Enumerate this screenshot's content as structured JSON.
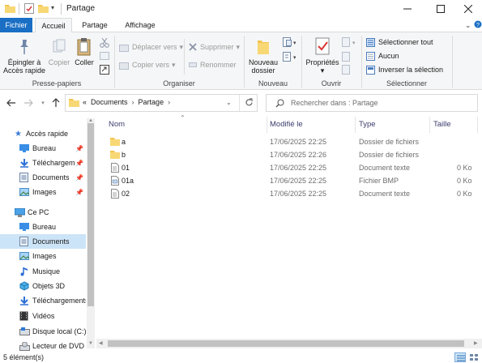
{
  "window": {
    "title": "Partage"
  },
  "tabs": {
    "file": "Fichier",
    "home": "Accueil",
    "share": "Partage",
    "view": "Affichage"
  },
  "ribbon": {
    "pin": "Épingler à\nAccès rapide",
    "pin_line1": "Épingler à",
    "pin_line2": "Accès rapide",
    "copy": "Copier",
    "paste": "Coller",
    "clipboard_group": "Presse-papiers",
    "move_to": "Déplacer vers",
    "copy_to": "Copier vers",
    "delete": "Supprimer",
    "rename": "Renommer",
    "organize_group": "Organiser",
    "new_folder_line1": "Nouveau",
    "new_folder_line2": "dossier",
    "new_group": "Nouveau",
    "properties": "Propriétés",
    "open_group": "Ouvrir",
    "select_all": "Sélectionner tout",
    "select_none": "Aucun",
    "invert_selection": "Inverser la sélection",
    "select_group": "Sélectionner"
  },
  "address": {
    "overflow": "«",
    "crumbs": [
      "Documents",
      "Partage"
    ],
    "search_placeholder": "Rechercher dans : Partage"
  },
  "nav": {
    "quick_access": "Accès rapide",
    "quick_items": [
      "Bureau",
      "Téléchargeme",
      "Documents",
      "Images"
    ],
    "this_pc": "Ce PC",
    "pc_items": [
      "Bureau",
      "Documents",
      "Images",
      "Musique",
      "Objets 3D",
      "Téléchargements",
      "Vidéos",
      "Disque local (C:)",
      "Lecteur de DVD ("
    ]
  },
  "columns": {
    "name": "Nom",
    "modified": "Modifié le",
    "type": "Type",
    "size": "Taille"
  },
  "files": [
    {
      "name": "a",
      "modified": "17/06/2025 22:25",
      "type": "Dossier de fichiers",
      "size": "",
      "icon": "folder-icon"
    },
    {
      "name": "b",
      "modified": "17/06/2025 22:26",
      "type": "Dossier de fichiers",
      "size": "",
      "icon": "folder-icon"
    },
    {
      "name": "01",
      "modified": "17/06/2025 22:25",
      "type": "Document texte",
      "size": "0 Ko",
      "icon": "text-file-icon"
    },
    {
      "name": "01a",
      "modified": "17/06/2025 22:25",
      "type": "Fichier BMP",
      "size": "0 Ko",
      "icon": "image-file-icon"
    },
    {
      "name": "02",
      "modified": "17/06/2025 22:25",
      "type": "Document texte",
      "size": "0 Ko",
      "icon": "text-file-icon"
    }
  ],
  "status": {
    "count": "5 élément(s)"
  },
  "colors": {
    "accent": "#1a6fc4",
    "selection": "#cce4f7",
    "folder": "#f3c550"
  }
}
